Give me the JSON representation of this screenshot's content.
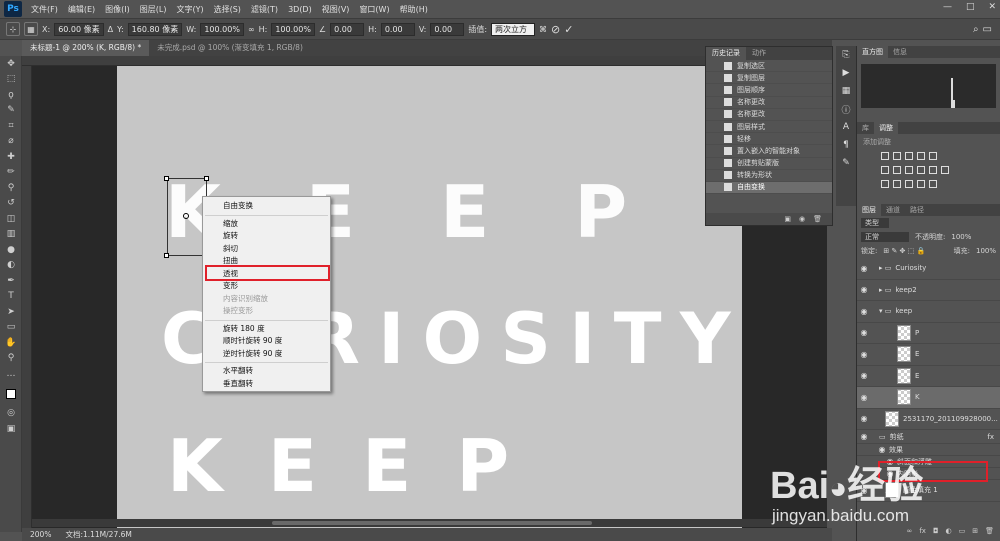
{
  "app": {
    "logo": "Ps"
  },
  "menubar": {
    "items": [
      "文件(F)",
      "编辑(E)",
      "图像(I)",
      "图层(L)",
      "文字(Y)",
      "选择(S)",
      "滤镜(T)",
      "3D(D)",
      "视图(V)",
      "窗口(W)",
      "帮助(H)"
    ]
  },
  "options": {
    "x_label": "X:",
    "x_value": "60.00 像素",
    "y_label": "Y:",
    "y_value": "160.80 像素",
    "w_label": "W:",
    "w_value": "100.00%",
    "h_label": "H:",
    "h_value": "100.00%",
    "angle_value": "0.00",
    "hskew_label": "H:",
    "hskew_value": "0.00",
    "vskew_label": "V:",
    "vskew_value": "0.00",
    "interp_label": "插值:",
    "interp_value": "两次立方"
  },
  "tabs": [
    {
      "label": "未标题-1 @ 200% (K, RGB/8) *"
    },
    {
      "label": "未完成.psd @ 100% (渐变填充 1, RGB/8)"
    }
  ],
  "canvas": {
    "row1": "K E E P",
    "row2": "C U R I O S I T Y",
    "row3": "K E E P"
  },
  "context_menu": {
    "items": [
      {
        "label": "自由变换",
        "enabled": true
      },
      {
        "sep": true
      },
      {
        "label": "缩放",
        "enabled": true
      },
      {
        "label": "旋转",
        "enabled": true
      },
      {
        "label": "斜切",
        "enabled": true
      },
      {
        "label": "扭曲",
        "enabled": true
      },
      {
        "label": "透视",
        "enabled": true
      },
      {
        "label": "变形",
        "enabled": true
      },
      {
        "label": "内容识别缩放",
        "enabled": false
      },
      {
        "label": "操控变形",
        "enabled": false
      },
      {
        "sep": true
      },
      {
        "label": "旋转 180 度",
        "enabled": true
      },
      {
        "label": "顺时针旋转 90 度",
        "enabled": true
      },
      {
        "label": "逆时针旋转 90 度",
        "enabled": true
      },
      {
        "sep": true
      },
      {
        "label": "水平翻转",
        "enabled": true
      },
      {
        "label": "垂直翻转",
        "enabled": true
      }
    ]
  },
  "history": {
    "tabs": [
      "历史记录",
      "动作"
    ],
    "items": [
      "复制选区",
      "复制图层",
      "图层顺序",
      "名称更改",
      "名称更改",
      "图层样式",
      "轻移",
      "置入嵌入的智能对象",
      "创建剪贴蒙版",
      "转换为形状",
      "自由变换"
    ]
  },
  "right_panel": {
    "nav_tabs": [
      "直方图",
      "信息"
    ],
    "adj_tabs": [
      "库",
      "调整"
    ],
    "adj_title": "添加调整",
    "layer_tabs": [
      "图层",
      "通道",
      "路径"
    ],
    "kind_label": "类型",
    "blend_mode": "正常",
    "opacity_label": "不透明度:",
    "opacity_value": "100%",
    "lock_label": "锁定:",
    "fill_label": "填充:",
    "fill_value": "100%",
    "layers": [
      {
        "name": "Curiosity",
        "type": "group"
      },
      {
        "name": "keep2",
        "type": "group"
      },
      {
        "name": "keep",
        "type": "group"
      },
      {
        "name": "P",
        "type": "layer"
      },
      {
        "name": "E",
        "type": "layer"
      },
      {
        "name": "E",
        "type": "layer"
      },
      {
        "name": "K",
        "type": "layer"
      },
      {
        "name": "2531170_201109928000...",
        "type": "layer"
      },
      {
        "name": "剪纸",
        "type": "layer"
      },
      {
        "name": "效果",
        "type": "fx"
      },
      {
        "name": "斜面和浮雕",
        "type": "fx"
      },
      {
        "name": "内阴影",
        "type": "fx"
      },
      {
        "name": "颜色填充 1",
        "type": "layer"
      }
    ]
  },
  "status": {
    "zoom": "200%",
    "doc": "文档:1.11M/27.6M"
  },
  "watermark": {
    "brand": "Bai",
    "brand2": "经验",
    "url": "jingyan.baidu.com"
  }
}
